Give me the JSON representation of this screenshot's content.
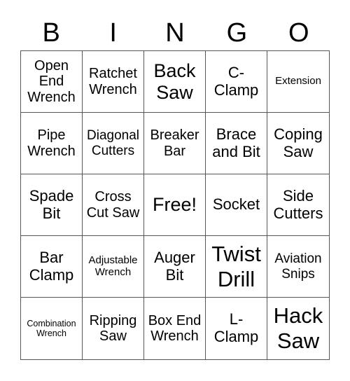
{
  "header": {
    "letters": [
      "B",
      "I",
      "N",
      "G",
      "O"
    ]
  },
  "cells": [
    "Open End Wrench",
    "Ratchet Wrench",
    "Back Saw",
    "C- Clamp",
    "Extension",
    "Pipe Wrench",
    "Diagonal Cutters",
    "Breaker Bar",
    "Brace and Bit",
    "Coping Saw",
    "Spade Bit",
    "Cross Cut Saw",
    "Free!",
    "Socket",
    "Side Cutters",
    "Bar Clamp",
    "Adjustable Wrench",
    "Auger Bit",
    "Twist Drill",
    "Aviation Snips",
    "Combination Wrench",
    "Ripping Saw",
    "Box End Wrench",
    "L- Clamp",
    "Hack Saw"
  ]
}
